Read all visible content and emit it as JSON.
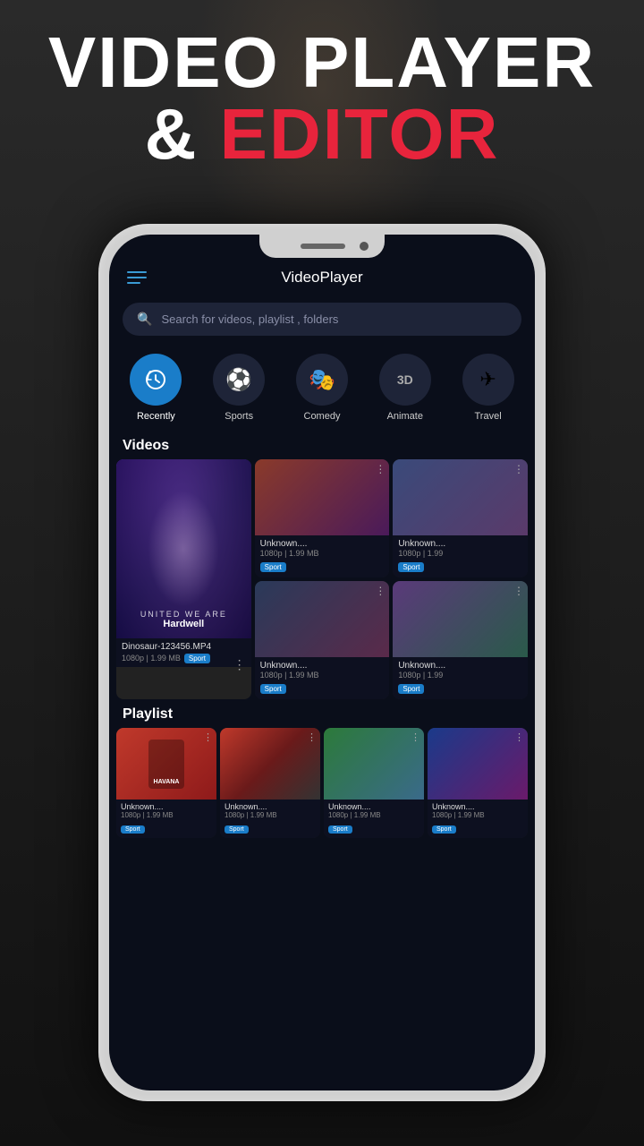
{
  "background": {
    "color": "#1a1a1a"
  },
  "hero": {
    "line1": "VIDEO PLAYER",
    "line2_amp": "&",
    "line2_editor": "EDITOR"
  },
  "app": {
    "title": "VideoPlayer",
    "search_placeholder": "Search for videos, playlist , folders",
    "menu_icon": "hamburger-menu"
  },
  "categories": [
    {
      "id": "recently",
      "label": "Recently",
      "icon": "↻",
      "active": true
    },
    {
      "id": "sports",
      "label": "Sports",
      "icon": "⚽",
      "active": false
    },
    {
      "id": "comedy",
      "label": "Comedy",
      "icon": "🎭",
      "active": false
    },
    {
      "id": "animate",
      "label": "Animate",
      "icon": "3D",
      "active": false
    },
    {
      "id": "travel",
      "label": "Travel",
      "icon": "✈",
      "active": false
    }
  ],
  "sections": {
    "videos_title": "Videos",
    "playlist_title": "Playlist"
  },
  "videos": [
    {
      "id": "large",
      "name": "Dinosaur-123456.MP4",
      "meta": "1080p | 1.99 MB",
      "badge": "Sport",
      "overlay_line1": "UNITED WE ARE",
      "overlay_line2": "Hardwell"
    },
    {
      "id": "v1",
      "name": "Unknown....",
      "meta": "1080p | 1.99 MB",
      "badge": "Sport"
    },
    {
      "id": "v2",
      "name": "Unknown....",
      "meta": "1080p | 1.99",
      "badge": "Sport"
    },
    {
      "id": "v3",
      "name": "Unknown....",
      "meta": "1080p | 1.99 MB",
      "badge": "Sport"
    },
    {
      "id": "v4",
      "name": "Unknown....",
      "meta": "1080p | 1.99",
      "badge": "Sport"
    }
  ],
  "playlists": [
    {
      "id": "pl1",
      "name": "Unknown....",
      "meta": "1080p | 1.99 MB",
      "badge": "Sport"
    },
    {
      "id": "pl2",
      "name": "Unknown....",
      "meta": "1080p | 1.99 MB",
      "badge": "Sport"
    },
    {
      "id": "pl3",
      "name": "Unknown....",
      "meta": "1080p | 1.99 MB",
      "badge": "Sport"
    },
    {
      "id": "pl4",
      "name": "Unknown....",
      "meta": "1080p | 1.99 MB",
      "badge": "Sport"
    }
  ],
  "colors": {
    "accent_blue": "#1a7dc9",
    "accent_red": "#e8243c",
    "bg_dark": "#0a0e1a",
    "card_bg": "#1e2438"
  }
}
